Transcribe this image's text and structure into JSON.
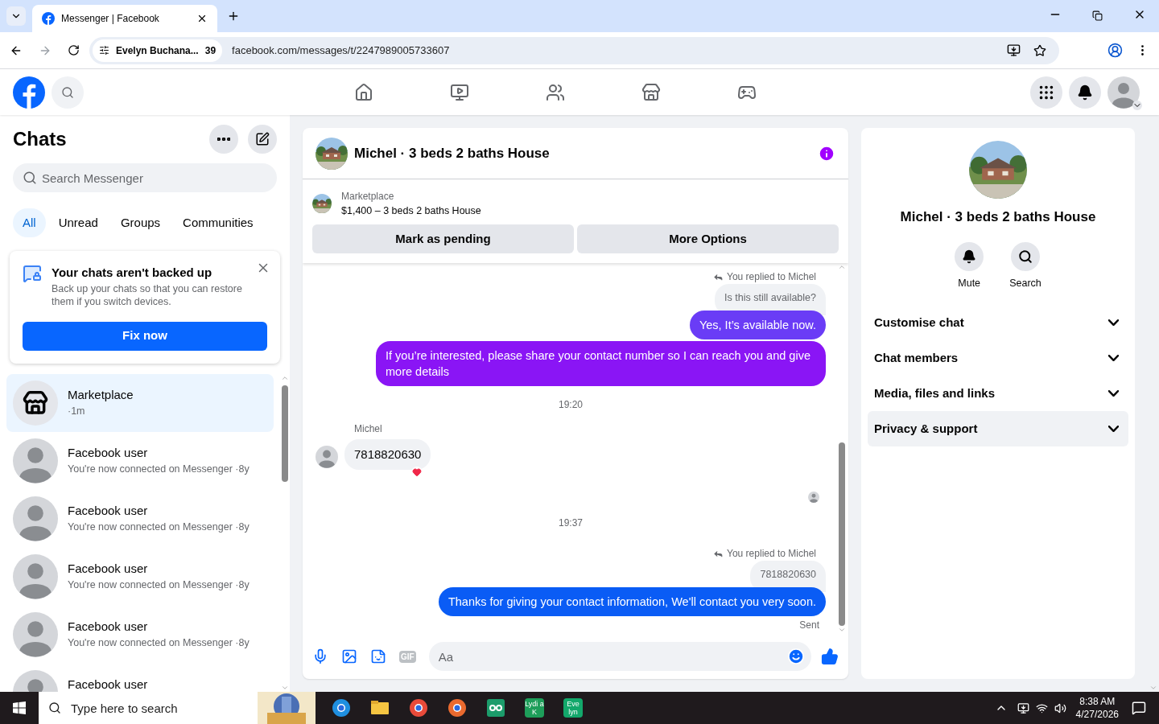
{
  "browser": {
    "tab_title": "Messenger | Facebook",
    "site_chip": {
      "label": "Evelyn Buchana...",
      "count": "39"
    },
    "url": "facebook.com/messages/t/2247989005733607"
  },
  "chats": {
    "title": "Chats",
    "search": {
      "placeholder": "Search Messenger"
    },
    "filters": [
      {
        "label": "All",
        "selected": true
      },
      {
        "label": "Unread",
        "selected": false
      },
      {
        "label": "Groups",
        "selected": false
      },
      {
        "label": "Communities",
        "selected": false
      }
    ],
    "backup_card": {
      "title": "Your chats aren't backed up",
      "body": "Back up your chats so that you can restore them if you switch devices.",
      "button": "Fix now"
    },
    "conversations": [
      {
        "kind": "marketplace",
        "name": "Marketplace",
        "time": "·1m",
        "selected": true
      },
      {
        "kind": "user",
        "name": "Facebook user",
        "preview": "You're now connected on Messenger",
        "time": "·8y",
        "selected": false
      },
      {
        "kind": "user",
        "name": "Facebook user",
        "preview": "You're now connected on Messenger",
        "time": "·8y",
        "selected": false
      },
      {
        "kind": "user",
        "name": "Facebook user",
        "preview": "You're now connected on Messenger",
        "time": "·8y",
        "selected": false
      },
      {
        "kind": "user",
        "name": "Facebook user",
        "preview": "You're now connected on Messenger",
        "time": "·8y",
        "selected": false
      },
      {
        "kind": "user",
        "name": "Facebook user",
        "selected": false
      }
    ]
  },
  "conversation": {
    "title": "Michel · 3 beds 2 baths House",
    "listing": {
      "label": "Marketplace",
      "text": "$1,400 – 3 beds 2 baths House"
    },
    "buttons": [
      "Mark as pending",
      "More Options"
    ],
    "messages": [
      {
        "kind": "reply_note",
        "text": "You replied to Michel"
      },
      {
        "kind": "quoted",
        "text": "Is this still available?"
      },
      {
        "kind": "outgoing",
        "text": "Yes, It’s available now.",
        "color": "#6a3cf6"
      },
      {
        "kind": "outgoing",
        "text": "If you’re interested, please share your contact number so I can reach you and give more details",
        "color": "#8a15f5"
      },
      {
        "kind": "timestamp",
        "text": "19:20"
      },
      {
        "kind": "sender",
        "text": "Michel"
      },
      {
        "kind": "incoming",
        "text": "7818820630",
        "reaction": true
      },
      {
        "kind": "seen"
      },
      {
        "kind": "timestamp",
        "text": "19:37"
      },
      {
        "kind": "reply_note",
        "text": "You replied to Michel"
      },
      {
        "kind": "quoted",
        "text": "7818820630"
      },
      {
        "kind": "outgoing",
        "text": "Thanks for giving your contact information, We'll contact you very soon.",
        "color": "#0a5cf5"
      },
      {
        "kind": "status",
        "text": "Sent"
      }
    ],
    "composer": {
      "gif_label": "GIF",
      "placeholder": "Aa"
    }
  },
  "details": {
    "name": "Michel · 3 beds 2 baths House",
    "actions": [
      {
        "kind": "mute",
        "label": "Mute"
      },
      {
        "kind": "search",
        "label": "Search"
      }
    ],
    "sections": [
      {
        "label": "Customise chat",
        "selected": false
      },
      {
        "label": "Chat members",
        "selected": false
      },
      {
        "label": "Media, files and links",
        "selected": false
      },
      {
        "label": "Privacy & support",
        "selected": true
      }
    ]
  },
  "taskbar": {
    "search_placeholder": "Type here to search",
    "tiles": [
      {
        "label": "Lydi a K",
        "color": "#1e9e5a"
      },
      {
        "label": "Eve lyn",
        "color": "#13a86b"
      }
    ],
    "time": "8:38 AM",
    "date": "4/27/2026"
  }
}
